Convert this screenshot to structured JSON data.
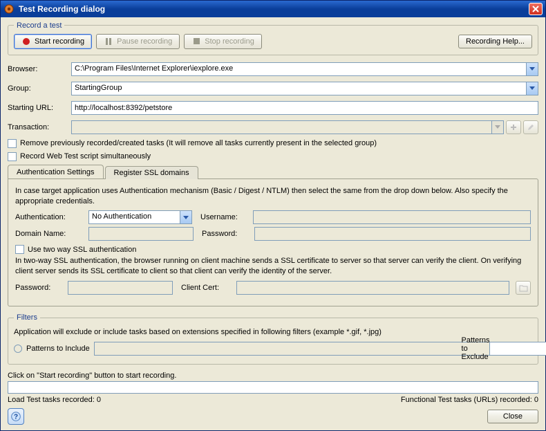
{
  "titlebar": {
    "title": "Test Recording dialog"
  },
  "record": {
    "legend": "Record a test",
    "start": "Start recording",
    "pause": "Pause recording",
    "stop": "Stop recording",
    "help": "Recording Help..."
  },
  "form": {
    "browser_label": "Browser:",
    "browser_value": "C:\\Program Files\\Internet Explorer\\iexplore.exe",
    "group_label": "Group:",
    "group_value": "StartingGroup",
    "url_label": "Starting URL:",
    "url_value": "http://localhost:8392/petstore",
    "txn_label": "Transaction:",
    "txn_value": "",
    "remove_chk": "Remove previously recorded/created tasks (It will remove all tasks currently present in the selected group)",
    "record_web_chk": "Record Web Test script simultaneously"
  },
  "tabs": {
    "auth": "Authentication Settings",
    "ssl": "Register SSL domains"
  },
  "auth": {
    "intro": "In case target application uses Authentication mechanism (Basic / Digest / NTLM) then select the same from the drop down below. Also specify the appropriate credentials.",
    "auth_label": "Authentication:",
    "auth_value": "No Authentication",
    "user_label": "Username:",
    "domain_label": "Domain Name:",
    "pass_label": "Password:",
    "twoway_chk": "Use two way SSL authentication",
    "twoway_desc": "In two-way SSL authentication, the browser running on client machine sends a SSL certificate to server so that server can verify the client. On verifying client server sends its SSL certificate to client so that client can verify the identity of the server.",
    "pwd2_label": "Password:",
    "clientcert_label": "Client Cert:"
  },
  "filters": {
    "legend": "Filters",
    "desc": "Application will exclude or include tasks based on extensions specified in following filters (example *.gif, *.jpg)",
    "include": "Patterns to Include",
    "exclude": "Patterns to Exclude"
  },
  "status": {
    "hint": "Click on \"Start recording\" button to start recording.",
    "load": "Load Test tasks recorded: 0",
    "func": "Functional Test tasks (URLs) recorded: 0"
  },
  "bottom": {
    "close": "Close"
  }
}
